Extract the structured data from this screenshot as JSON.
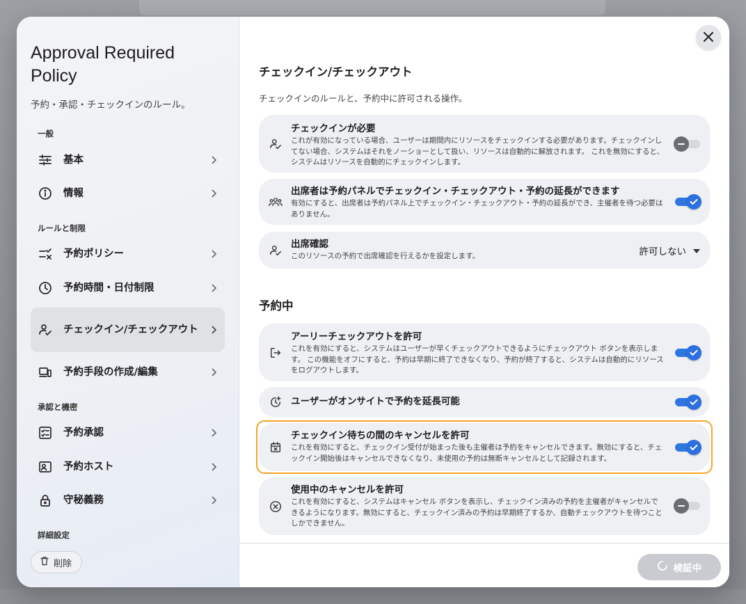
{
  "sidebar": {
    "title": "Approval Required Policy",
    "subtitle": "予約・承認・チェックインのルール。",
    "sections": {
      "general": "一般",
      "rules": "ルールと制限",
      "approval": "承認と機密",
      "advanced": "詳細設定"
    },
    "items": {
      "basic": "基本",
      "info": "情報",
      "policy": "予約ポリシー",
      "time": "予約時間・日付制限",
      "checkin": "チェックイン/チェックアウト",
      "method": "予約手段の作成/編集",
      "approval": "予約承認",
      "host": "予約ホスト",
      "confidential": "守秘義務"
    },
    "delete_label": "削除"
  },
  "main": {
    "section1": {
      "title": "チェックイン/チェックアウト",
      "desc": "チェックインのルールと、予約中に許可される操作。"
    },
    "section2": {
      "title": "予約中"
    },
    "cards": {
      "checkin_required": {
        "title": "チェックインが必要",
        "desc": "これが有効になっている場合、ユーザーは期間内にリソースをチェックインする必要があります。チェックインしてない場合、システムはそれをノーショーとして扱い、リソースは自動的に解放されます。 これを無効にすると、システムはリソースを自動的にチェックインします。",
        "enabled": false
      },
      "attendee_panel": {
        "title": "出席者は予約パネルでチェックイン・チェックアウト・予約の延長ができます",
        "desc": "有効にすると、出席者は予約パネル上でチェックイン・チェックアウト・予約の延長ができ、主催者を待つ必要はありません。",
        "enabled": true
      },
      "attendance": {
        "title": "出席確認",
        "desc": "このリソースの予約で出席確認を行えるかを設定します。",
        "value": "許可しない"
      },
      "early_checkout": {
        "title": "アーリーチェックアウトを許可",
        "desc": "これを有効にすると、システムはユーザーが早くチェックアウトできるようにチェックアウト ボタンを表示します。 この機能をオフにすると、予約は早期に終了できなくなり、予約が終了すると、システムは自動的にリソースをログアウトします。",
        "enabled": true
      },
      "extend_onsite": {
        "title": "ユーザーがオンサイトで予約を延長可能",
        "enabled": true
      },
      "cancel_waiting": {
        "title": "チェックイン待ちの間のキャンセルを許可",
        "desc": "これを有効にすると、チェックイン受付が始まった後も主催者は予約をキャンセルできます。無効にすると、チェックイン開始後はキャンセルできなくなり、未使用の予約は無断キャンセルとして記録されます。",
        "enabled": true
      },
      "cancel_in_use": {
        "title": "使用中のキャンセルを許可",
        "desc": "これを有効にすると、システムはキャンセル ボタンを表示し、チェックイン済みの予約を主催者がキャンセルできるようになります。無効にすると、チェックイン済みの予約は早期終了するか、自動チェックアウトを待つことしかできません。",
        "enabled": false
      }
    }
  },
  "footer": {
    "verify_label": "検証中"
  },
  "colors": {
    "accent": "#2b6fe0",
    "highlight": "#f4a428",
    "card_bg": "#eef0f3"
  }
}
